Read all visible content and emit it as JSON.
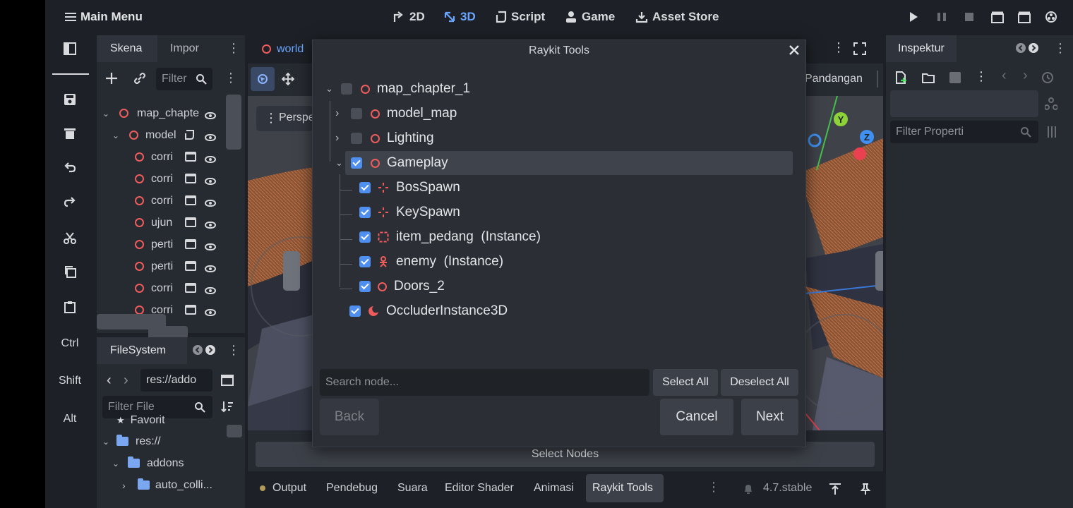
{
  "topbar": {
    "main_menu": "Main Menu",
    "workspaces": [
      {
        "label": "2D",
        "icon": "2d-icon"
      },
      {
        "label": "3D",
        "icon": "3d-icon"
      },
      {
        "label": "Script",
        "icon": "script-icon"
      },
      {
        "label": "Game",
        "icon": "game-icon"
      },
      {
        "label": "Asset Store",
        "icon": "download-icon"
      }
    ]
  },
  "left_toolbar": {
    "ctrl": "Ctrl",
    "shift": "Shift",
    "alt": "Alt"
  },
  "scene_panel": {
    "tabs": [
      "Skena",
      "Impor"
    ],
    "filter_placeholder": "Filter",
    "nodes": [
      {
        "label": "map_chapte"
      },
      {
        "label": "model"
      },
      {
        "label": "corri"
      },
      {
        "label": "corri"
      },
      {
        "label": "corri"
      },
      {
        "label": "ujun"
      },
      {
        "label": "perti"
      },
      {
        "label": "perti"
      },
      {
        "label": "corri"
      },
      {
        "label": "corri"
      }
    ]
  },
  "filesystem": {
    "tab": "FileSystem",
    "path": "res://addo",
    "filter_placeholder": "Filter File",
    "favorites": "Favorit",
    "items": [
      "res://",
      "addons",
      "auto_colli..."
    ]
  },
  "editor_tabs": {
    "scene_tab": "world",
    "perspective": "Perspe",
    "view_menu": "Pandangan"
  },
  "inspector": {
    "tab": "Inspektur",
    "filter_placeholder": "Filter Properti"
  },
  "dialog": {
    "title": "Raykit Tools",
    "tree": [
      {
        "label": "map_chapter_1",
        "checked": false,
        "expanded": true
      },
      {
        "label": "model_map",
        "checked": false,
        "expanded": false
      },
      {
        "label": "Lighting",
        "checked": false,
        "expanded": false
      },
      {
        "label": "Gameplay",
        "checked": true,
        "expanded": true
      },
      {
        "label": "BosSpawn",
        "checked": true
      },
      {
        "label": "KeySpawn",
        "checked": true
      },
      {
        "label": "item_pedang  (Instance)",
        "checked": true
      },
      {
        "label": "enemy  (Instance)",
        "checked": true
      },
      {
        "label": "Doors_2",
        "checked": true
      },
      {
        "label": "OccluderInstance3D",
        "checked": true
      }
    ],
    "search_placeholder": "Search node...",
    "select_all": "Select All",
    "deselect_all": "Deselect All",
    "back": "Back",
    "cancel": "Cancel",
    "next": "Next"
  },
  "bottom": {
    "select_nodes": "Select Nodes",
    "tabs": [
      "Output",
      "Pendebug",
      "Suara",
      "Editor Shader",
      "Animasi",
      "Raykit Tools"
    ],
    "version": "4.7.stable"
  },
  "colors": {
    "accent": "#4f8ff0",
    "node_red": "#ee5c5c",
    "panel": "#262a31",
    "background": "#1d2026"
  }
}
